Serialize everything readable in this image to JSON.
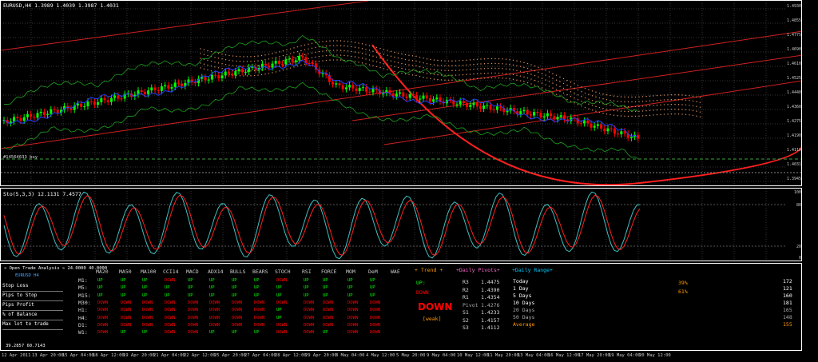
{
  "chart_header": "EURUSD,H4  1.3989 1.4039 1.3987 1.4031",
  "buy_label": "#14564633 buy",
  "price_axis": [
    "1.4930",
    "1.4855",
    "1.4775",
    "1.4690",
    "1.4610",
    "1.4525",
    "1.4440",
    "1.4360",
    "1.4275",
    "1.4190",
    "1.4110",
    "1.4031",
    "1.3945"
  ],
  "stoch_header": "Sto(5,3,3) 12.1131 7.4577",
  "stoch_axis": [
    "100",
    "80",
    "20",
    "0"
  ],
  "panel": {
    "title": "» Open Trade Analysis » 24.0000 40.0000",
    "symbol": "EURUSD  H4",
    "left_labels": [
      "Stop Loss",
      "Pips to Stop",
      "Pips Profit",
      "% of Balance",
      "Max lot to trade"
    ],
    "bottom_readout": "39.2857 60.7143",
    "indicators": [
      "MA20",
      "MA50",
      "MA100",
      "CCI14",
      "MACD",
      "ADX14",
      "BULLS",
      "BEARS",
      "STOCH",
      "RSI",
      "FORCE",
      "MOM",
      "DeM",
      "WAE"
    ],
    "timeframes": [
      "M1:",
      "M5:",
      "M15:",
      "M30:",
      "H1:",
      "H4:",
      "D1:",
      "W1:"
    ],
    "grid": [
      [
        "UP",
        "UP",
        "UP",
        "DOWN",
        "UP",
        "UP",
        "UP",
        "UP",
        "DOWN",
        "UP",
        "UP",
        "UP",
        "UP",
        ""
      ],
      [
        "UP",
        "UP",
        "UP",
        "UP",
        "UP",
        "UP",
        "UP",
        "UP",
        "UP",
        "UP",
        "UP",
        "UP",
        "UP",
        ""
      ],
      [
        "UP",
        "UP",
        "UP",
        "UP",
        "UP",
        "UP",
        "UP",
        "UP",
        "UP",
        "UP",
        "UP",
        "UP",
        "UP",
        ""
      ],
      [
        "DOWN",
        "DOWN",
        "DOWN",
        "DOWN",
        "DOWN",
        "DOWN",
        "DOWN",
        "DOWN",
        "DOWN",
        "DOWN",
        "DOWN",
        "DOWN",
        "DOWN",
        ""
      ],
      [
        "DOWN",
        "DOWN",
        "DOWN",
        "DOWN",
        "DOWN",
        "DOWN",
        "DOWN",
        "DOWN",
        "UP",
        "DOWN",
        "DOWN",
        "DOWN",
        "DOWN",
        ""
      ],
      [
        "DOWN",
        "DOWN",
        "DOWN",
        "DOWN",
        "DOWN",
        "DOWN",
        "DOWN",
        "DOWN",
        "UP",
        "DOWN",
        "DOWN",
        "DOWN",
        "DOWN",
        ""
      ],
      [
        "DOWN",
        "DOWN",
        "DOWN",
        "DOWN",
        "DOWN",
        "DOWN",
        "DOWN",
        "DOWN",
        "DOWN",
        "DOWN",
        "DOWN",
        "DOWN",
        "DOWN",
        ""
      ],
      [
        "DOWN",
        "UP",
        "UP",
        "DOWN",
        "DOWN",
        "UP",
        "UP",
        "UP",
        "DOWN",
        "DOWN",
        "UP",
        "DOWN",
        "DOWN",
        ""
      ]
    ],
    "trend_title": "Trend",
    "trend_up": "UP:",
    "trend_down": "DOWN",
    "trend_big": "DOWN",
    "trend_strength": "[weak]",
    "pivots_title": "Daily Pivots",
    "pivots": [
      [
        "R3",
        "1.4475"
      ],
      [
        "R2",
        "1.4390"
      ],
      [
        "R1",
        "1.4354"
      ],
      [
        "Pivot",
        "1.4276"
      ],
      [
        "S1",
        "1.4233"
      ],
      [
        "S2",
        "1.4157"
      ],
      [
        "S3",
        "1.4112"
      ]
    ],
    "range_title": "Daily Range",
    "range": [
      [
        "Today",
        "172"
      ],
      [
        "1 Day",
        "121"
      ],
      [
        "5 Days",
        "160"
      ],
      [
        "10 Days",
        "181"
      ],
      [
        "20 Days",
        "165"
      ],
      [
        "50 Days",
        "148"
      ],
      [
        "Average",
        "155"
      ]
    ],
    "pct1": "39%",
    "pct2": "61%"
  },
  "time_axis": [
    "12 Apr 2011",
    "13 Apr 20:00",
    "15 Apr 04:00",
    "18 Apr 12:00",
    "19 Apr 20:00",
    "21 Apr 04:00",
    "22 Apr 12:00",
    "25 Apr 20:00",
    "27 Apr 04:00",
    "28 Apr 12:00",
    "29 Apr 20:00",
    "3 May 04:00",
    "4 May 12:00",
    "5 May 20:00",
    "9 May 04:00",
    "10 May 12:00",
    "11 May 20:00",
    "13 May 04:00",
    "16 May 12:00",
    "17 May 20:00",
    "19 May 04:00",
    "20 May 12:00"
  ],
  "colors": {
    "bull": "#00ff00",
    "bear": "#ff0000",
    "line": "#ff2020",
    "ma_blue": "#2040ff",
    "ichi": "#d89060",
    "grid": "#444444"
  }
}
